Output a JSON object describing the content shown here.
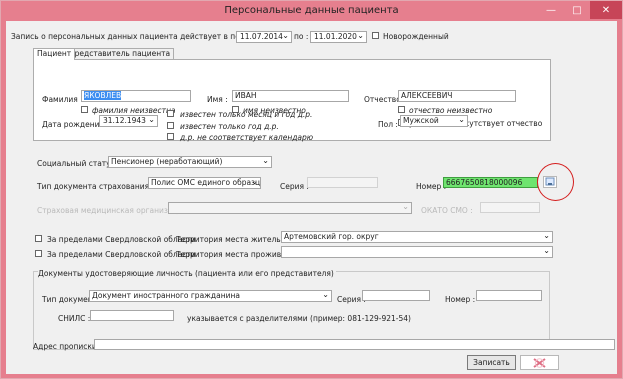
{
  "window": {
    "title": "Персональные данные пациента",
    "controls": {
      "minimize": "—",
      "maximize": "□",
      "close": "✕"
    }
  },
  "period": {
    "label": "Запись о персональных данных пациента  действует в период с :",
    "from": "11.07.2014",
    "to_label": "по :",
    "to": "11.01.2020",
    "newborn_label": "Новорожденный"
  },
  "tabs": [
    "Пациент",
    "Представитель пациента"
  ],
  "patient": {
    "lastname_label": "Фамилия :",
    "lastname": "ЯКОВЛЕВ",
    "lastname_unknown_label": "фамилия неизвестна",
    "firstname_label": "Имя :",
    "firstname": "ИВАН",
    "firstname_unknown_label": "имя неизвестно",
    "patronymic_label": "Отчество :",
    "patronymic": "АЛЕКСЕЕВИЧ",
    "patronymic_unknown_label": "отчество неизвестно",
    "patronymic_missing_label": "у пациента отсутствует отчество",
    "birthdate_label": "Дата рождения :",
    "birthdate": "31.12.1943",
    "birth_known_month_year": "известен только месяц и год д.р.",
    "birth_known_year": "известен только  год д.р.",
    "birth_not_calendar": "д.р. не соответствует календарю",
    "sex_label": "Пол :",
    "sex": "Мужской"
  },
  "social": {
    "label": "Социальный статус :",
    "value": "Пенсионер (неработающий)"
  },
  "insurance": {
    "doc_type_label": "Тип документа страхования ОМС :",
    "doc_type": "Полис ОМС единого образца",
    "series_label": "Серия :",
    "number_label": "Номер :",
    "number": "6667650818000096",
    "org_label": "Страховая медицинская организация :",
    "okato_label": "ОКАТО СМО :"
  },
  "territory": {
    "outside_region_label": "За пределами Свердловской области",
    "residence_label": "Территория места жительства :",
    "residence": "Артемовский гор. округ",
    "stay_label": "Территория места проживания :"
  },
  "identity": {
    "group_title": "Документы удостоверяющие личность (пациента или его представителя)",
    "doc_type_label": "Тип документа",
    "doc_type": "Документ иностранного гражданина",
    "series_label": "Серия :",
    "number_label": "Номер :",
    "snils_label": "СНИЛС :",
    "snils_hint": "указывается с разделителями (пример: 081-129-921-54)"
  },
  "address": {
    "label": "Адрес прописки :"
  },
  "buttons": {
    "save": "Записать"
  },
  "colors": {
    "titlebar": "#e67f8e",
    "close": "#c74558",
    "highlight": "#3b8df1",
    "valid_field": "#6fe46f",
    "annotation": "#d41d1d"
  }
}
